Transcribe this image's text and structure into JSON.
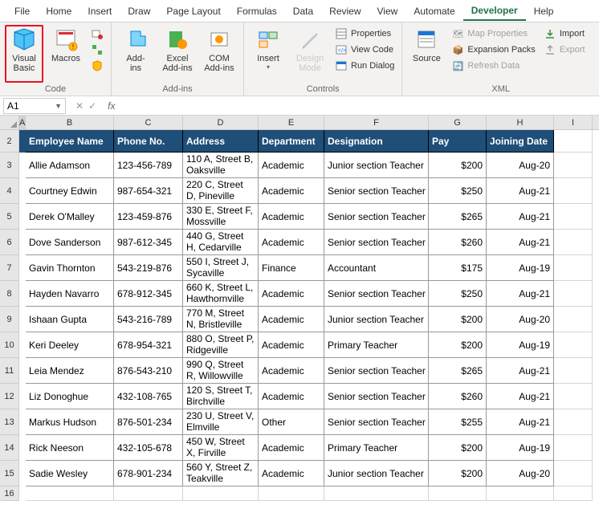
{
  "tabs": {
    "file": "File",
    "home": "Home",
    "insert": "Insert",
    "draw": "Draw",
    "page_layout": "Page Layout",
    "formulas": "Formulas",
    "data": "Data",
    "review": "Review",
    "view": "View",
    "automate": "Automate",
    "developer": "Developer",
    "help": "Help"
  },
  "ribbon": {
    "code": {
      "label": "Code",
      "visual_basic": "Visual\nBasic",
      "macros": "Macros"
    },
    "addins": {
      "label": "Add-ins",
      "addins": "Add-\nins",
      "excel_addins": "Excel\nAdd-ins",
      "com_addins": "COM\nAdd-ins"
    },
    "controls": {
      "label": "Controls",
      "insert": "Insert",
      "design": "Design\nMode",
      "properties": "Properties",
      "view_code": "View Code",
      "run_dialog": "Run Dialog"
    },
    "xml": {
      "label": "XML",
      "source": "Source",
      "map_props": "Map Properties",
      "expansion": "Expansion Packs",
      "refresh": "Refresh Data",
      "import": "Import",
      "export": "Export"
    }
  },
  "namebox": "A1",
  "columns": [
    "A",
    "B",
    "C",
    "D",
    "E",
    "F",
    "G",
    "H",
    "I"
  ],
  "headers": {
    "b": "Employee Name",
    "c": "Phone No.",
    "d": "Address",
    "e": "Department",
    "f": "Designation",
    "g": "Pay",
    "h": "Joining Date"
  },
  "rows": [
    {
      "n": 3,
      "b": "Allie Adamson",
      "c": "123-456-789",
      "d": "110 A, Street B, Oaksville",
      "e": "Academic",
      "f": "Junior section Teacher",
      "g": "$200",
      "h": "Aug-20"
    },
    {
      "n": 4,
      "b": "Courtney Edwin",
      "c": "987-654-321",
      "d": "220 C, Street D, Pineville",
      "e": "Academic",
      "f": "Senior section Teacher",
      "g": "$250",
      "h": "Aug-21"
    },
    {
      "n": 5,
      "b": "Derek O'Malley",
      "c": "123-459-876",
      "d": "330 E, Street F, Mossville",
      "e": "Academic",
      "f": "Senior section Teacher",
      "g": "$265",
      "h": "Aug-21"
    },
    {
      "n": 6,
      "b": "Dove Sanderson",
      "c": "987-612-345",
      "d": "440 G, Street H, Cedarville",
      "e": "Academic",
      "f": "Senior section Teacher",
      "g": "$260",
      "h": "Aug-21"
    },
    {
      "n": 7,
      "b": "Gavin Thornton",
      "c": "543-219-876",
      "d": "550 I, Street J, Sycaville",
      "e": "Finance",
      "f": "Accountant",
      "g": "$175",
      "h": "Aug-19"
    },
    {
      "n": 8,
      "b": "Hayden Navarro",
      "c": "678-912-345",
      "d": "660 K, Street L, Hawthornville",
      "e": "Academic",
      "f": "Senior section Teacher",
      "g": "$250",
      "h": "Aug-21"
    },
    {
      "n": 9,
      "b": "Ishaan Gupta",
      "c": "543-216-789",
      "d": "770 M, Street N, Bristleville",
      "e": "Academic",
      "f": "Junior section Teacher",
      "g": "$200",
      "h": "Aug-20"
    },
    {
      "n": 10,
      "b": "Keri Deeley",
      "c": "678-954-321",
      "d": "880 O, Street P, Ridgeville",
      "e": "Academic",
      "f": "Primary Teacher",
      "g": "$200",
      "h": "Aug-19"
    },
    {
      "n": 11,
      "b": "Leia Mendez",
      "c": "876-543-210",
      "d": "990 Q, Street R, Willowville",
      "e": "Academic",
      "f": "Senior section Teacher",
      "g": "$265",
      "h": "Aug-21"
    },
    {
      "n": 12,
      "b": "Liz Donoghue",
      "c": "432-108-765",
      "d": "120 S, Street T, Birchville",
      "e": "Academic",
      "f": "Senior section Teacher",
      "g": "$260",
      "h": "Aug-21"
    },
    {
      "n": 13,
      "b": "Markus Hudson",
      "c": "876-501-234",
      "d": "230 U, Street V, Elmville",
      "e": "Other",
      "f": "Senior section Teacher",
      "g": "$255",
      "h": "Aug-21"
    },
    {
      "n": 14,
      "b": "Rick Neeson",
      "c": "432-105-678",
      "d": "450 W, Street X, Firville",
      "e": "Academic",
      "f": "Primary Teacher",
      "g": "$200",
      "h": "Aug-19"
    },
    {
      "n": 15,
      "b": "Sadie Wesley",
      "c": "678-901-234",
      "d": "560 Y, Street Z, Teakville",
      "e": "Academic",
      "f": "Junior section Teacher",
      "g": "$200",
      "h": "Aug-20"
    }
  ]
}
